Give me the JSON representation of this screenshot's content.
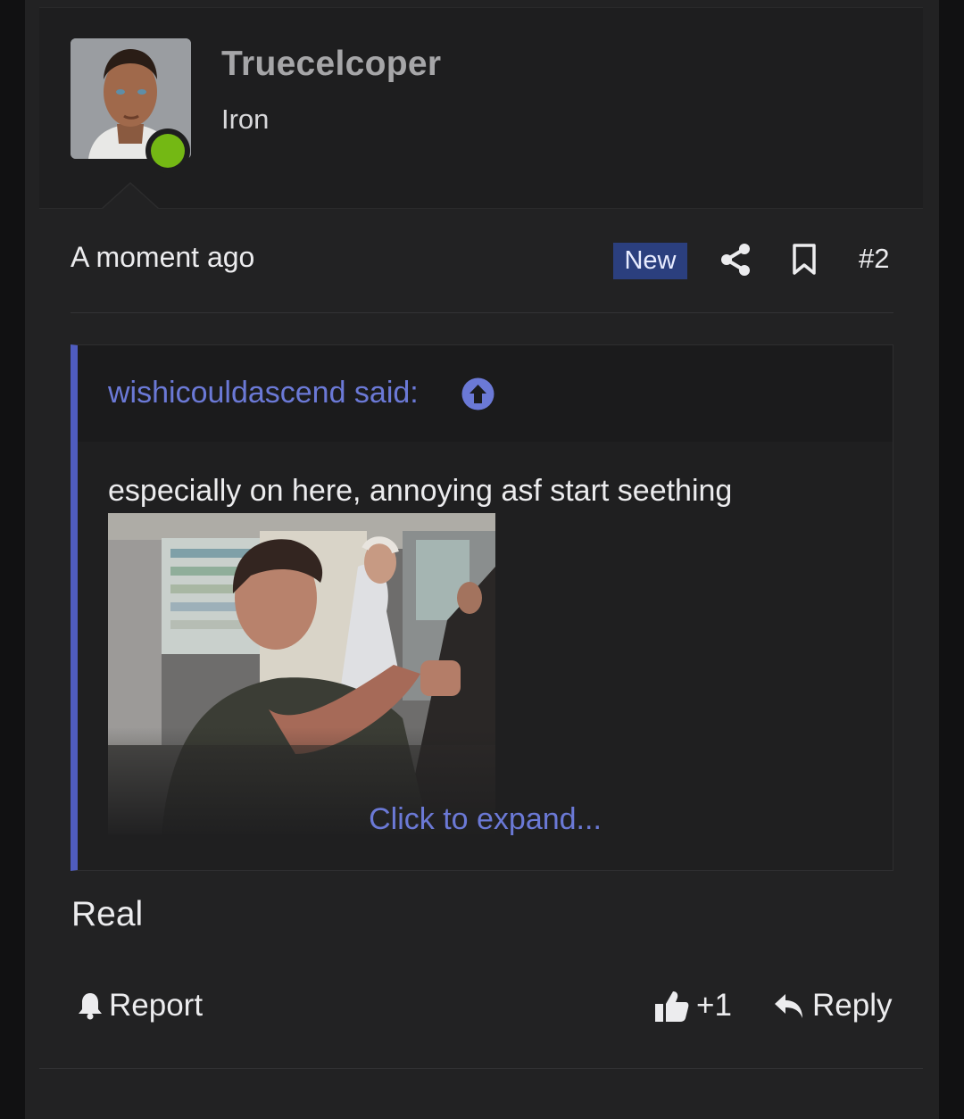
{
  "post": {
    "author": {
      "username": "Truecelcoper",
      "title": "Iron",
      "online": true,
      "online_color": "#74b814"
    },
    "timestamp": "A moment ago",
    "badge": "New",
    "number": "#2",
    "icons": {
      "share": "share-icon",
      "bookmark": "bookmark-icon"
    },
    "quote": {
      "author": "wishicouldascend said:",
      "text": "especially on here, annoying asf start seething",
      "media": "gif-image",
      "expand": "Click to expand...",
      "accent_color": "#4f5cbf"
    },
    "message": "Real",
    "actions": {
      "report": "Report",
      "reaction_count": "+1",
      "reply": "Reply"
    }
  }
}
